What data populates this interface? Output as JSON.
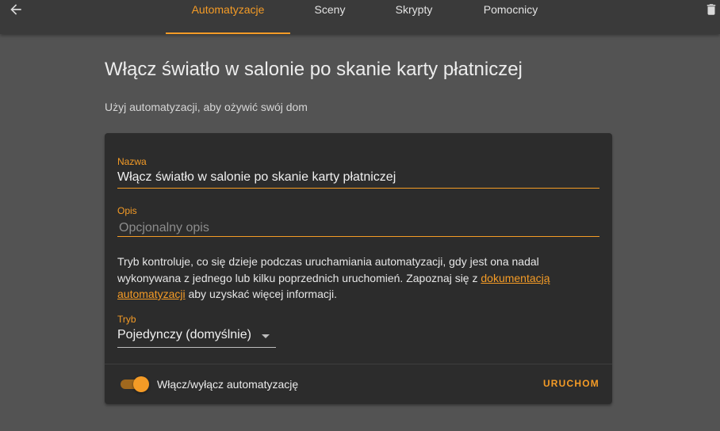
{
  "header": {
    "back_icon": "arrow-left-icon",
    "delete_icon": "trash-icon",
    "tabs": [
      {
        "label": "Automatyzacje",
        "active": true
      },
      {
        "label": "Sceny",
        "active": false
      },
      {
        "label": "Skrypty",
        "active": false
      },
      {
        "label": "Pomocnicy",
        "active": false
      }
    ]
  },
  "page": {
    "title": "Włącz światło w salonie po skanie karty płatniczej",
    "subtitle": "Użyj automatyzacji, aby ożywić swój dom"
  },
  "form": {
    "name_label": "Nazwa",
    "name_value": "Włącz światło w salonie po skanie karty płatniczej",
    "description_label": "Opis",
    "description_placeholder": "Opcjonalny opis",
    "help_text_before": "Tryb kontroluje, co się dzieje podczas uruchamiania automatyzacji, gdy jest ona nadal wykonywana z jednego lub kilku poprzednich uruchomień. Zapoznaj się z ",
    "help_link": "dokumentacją automatyzacji",
    "help_text_after": " aby uzyskać więcej informacji.",
    "mode_label": "Tryb",
    "mode_value": "Pojedynczy (domyślnie)"
  },
  "footer": {
    "toggle_label": "Włącz/wyłącz automatyzację",
    "toggle_on": true,
    "run_label": "URUCHOM"
  },
  "colors": {
    "accent": "#f49b26",
    "background": "#535353",
    "card": "#2c2c2c",
    "topbar": "#3a3a3a"
  }
}
